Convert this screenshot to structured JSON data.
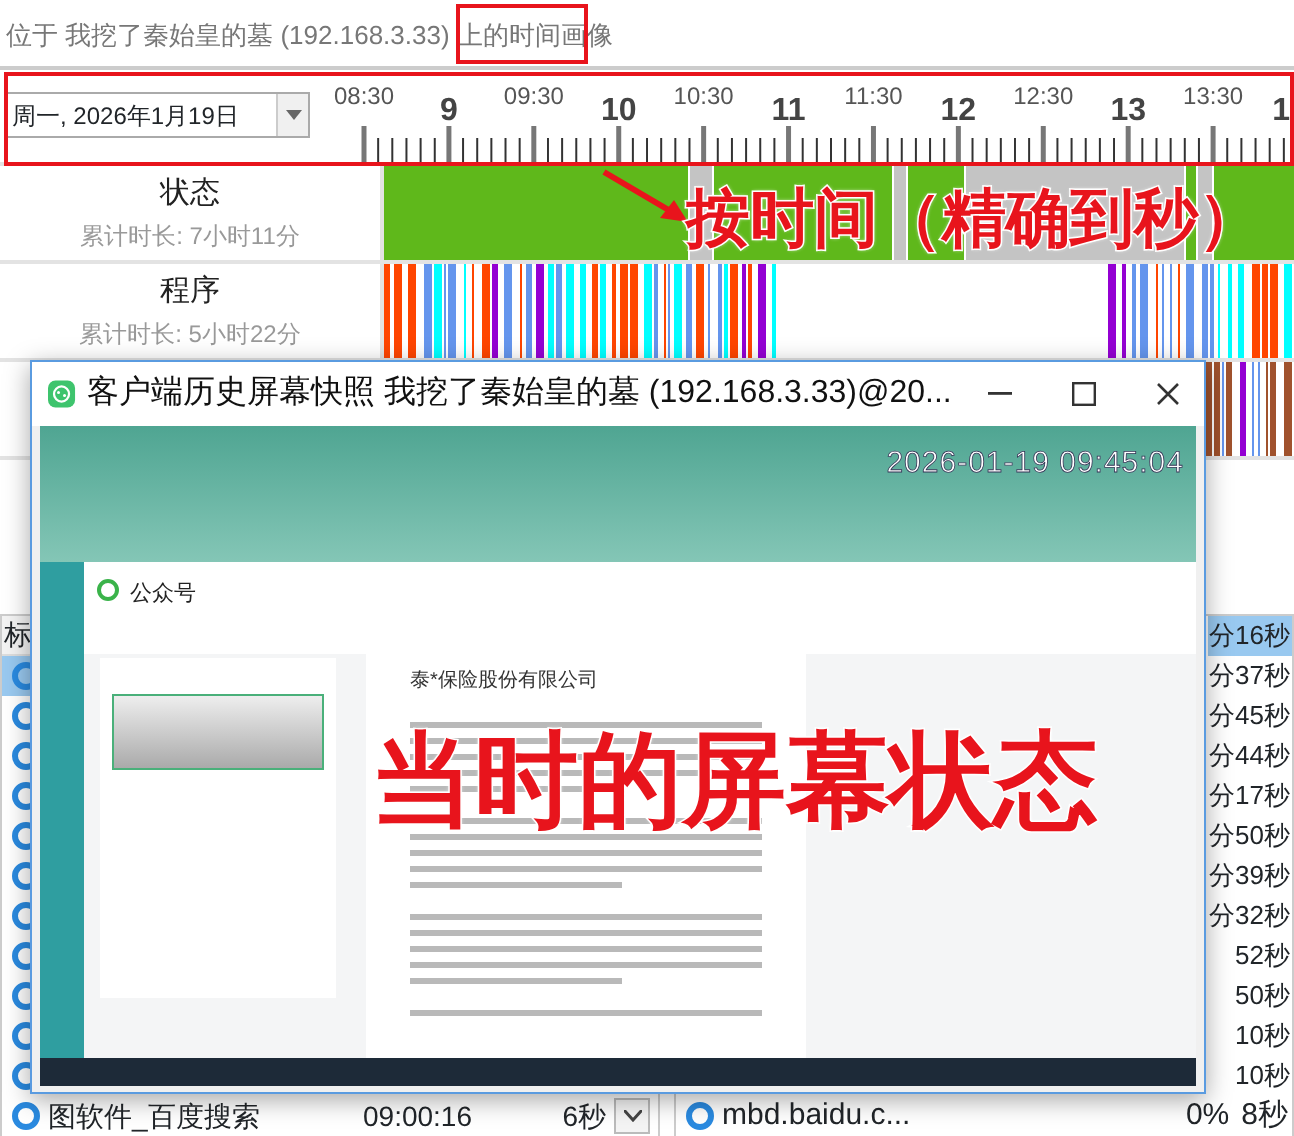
{
  "header": {
    "caption": "位于 我挖了秦始皇的墓 (192.168.3.33) 上的时间画像"
  },
  "timeline": {
    "date": "周一, 2026年1月19日",
    "tick_labels": [
      {
        "label": "08:30",
        "kind": "half"
      },
      {
        "label": "9",
        "kind": "hour"
      },
      {
        "label": "09:30",
        "kind": "half"
      },
      {
        "label": "10",
        "kind": "hour"
      },
      {
        "label": "10:30",
        "kind": "half"
      },
      {
        "label": "11",
        "kind": "hour"
      },
      {
        "label": "11:30",
        "kind": "half"
      },
      {
        "label": "12",
        "kind": "hour"
      },
      {
        "label": "12:30",
        "kind": "half"
      },
      {
        "label": "13",
        "kind": "hour"
      },
      {
        "label": "13:30",
        "kind": "half"
      },
      {
        "label": "1",
        "kind": "hour"
      }
    ]
  },
  "tracks": [
    {
      "kind": "status",
      "title": "状态",
      "total": "累计时长: 7小时11分"
    },
    {
      "kind": "programs",
      "title": "程序",
      "total": "累计时长: 5小时22分"
    },
    {
      "kind": "sites"
    }
  ],
  "app_table": {
    "columns": [
      "标"
    ],
    "rows": [
      {
        "selected": true
      },
      {
        "selected": false
      },
      {
        "selected": false
      },
      {
        "selected": false
      },
      {
        "selected": false
      },
      {
        "selected": false
      },
      {
        "selected": false
      },
      {
        "selected": false
      },
      {
        "selected": false
      },
      {
        "selected": false
      },
      {
        "selected": false
      },
      {
        "selected": false,
        "name": "图软件_百度搜索",
        "time": "09:00:16",
        "duration": "6秒",
        "dropdown": true
      }
    ]
  },
  "site_table": {
    "rows": [
      {
        "selected": true,
        "duration": "分16秒"
      },
      {
        "selected": false,
        "duration": "分37秒"
      },
      {
        "selected": false,
        "duration": "分45秒"
      },
      {
        "selected": false,
        "duration": "分44秒"
      },
      {
        "selected": false,
        "duration": "分17秒"
      },
      {
        "selected": false,
        "duration": "分50秒"
      },
      {
        "selected": false,
        "duration": "分39秒"
      },
      {
        "selected": false,
        "duration": "分32秒"
      },
      {
        "selected": false,
        "duration": "52秒"
      },
      {
        "selected": false,
        "duration": "50秒"
      },
      {
        "selected": false,
        "duration": "10秒"
      },
      {
        "selected": false,
        "duration": "10秒"
      },
      {
        "selected": false,
        "name": "mbd.baidu.c...",
        "share": "0%",
        "duration": "8秒"
      }
    ]
  },
  "snapshot_window": {
    "title": "客户端历史屏幕快照 我挖了秦始皇的墓 (192.168.3.33)@20...",
    "timestamp": "2026-01-19 09:45:04",
    "account_label": "公众号",
    "article_title": "泰*保险股份有限公司"
  },
  "annotations": [
    {
      "kind": "timeline",
      "text": "按时间（精确到秒）"
    },
    {
      "kind": "snapshot",
      "text": "当时的屏幕状态"
    }
  ]
}
